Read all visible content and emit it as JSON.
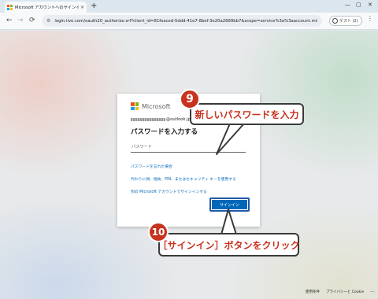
{
  "browser": {
    "tab_title": "Microsoft アカウントへのサインイン",
    "tab_close": "×",
    "new_tab": "+",
    "url": "login.live.com/oauth20_authorize.srf?client_id=81feaced-5ddd-41e7-8bef-3e20a2689bb7&scope=service%3a%3aaccount.microsoft...",
    "guest_label": "ゲスト (2)",
    "back_icon": "←",
    "forward_icon": "→",
    "reload_icon": "⟳",
    "menu_icon": "⋮",
    "minimize_icon": "—",
    "maximize_icon": "▢",
    "close_icon": "✕"
  },
  "signin": {
    "brand": "Microsoft",
    "account_suffix": "@outlook.jp",
    "heading": "パスワードを入力する",
    "password_placeholder": "パスワード",
    "link_forgot": "パスワードを忘れた場合",
    "link_other": "代わりに顔、指紋、PIN、またはセキュリティ キーを使用する",
    "link_other_account": "別の Microsoft アカウントでサインインする",
    "signin_button": "サインイン"
  },
  "annotations": {
    "step9_number": "9",
    "step9_text": "新しいパスワードを入力",
    "step10_number": "10",
    "step10_text": "［サインイン］ボタンをクリック"
  },
  "footer": {
    "terms": "使用条件",
    "privacy": "プライバシーと Cookie",
    "more": "..."
  },
  "colors": {
    "ms_red": "#f25022",
    "ms_green": "#7fba00",
    "ms_blue": "#00a4ef",
    "ms_yellow": "#ffb900",
    "accent_blue": "#0067b8",
    "annotation_red": "#c8321e"
  }
}
